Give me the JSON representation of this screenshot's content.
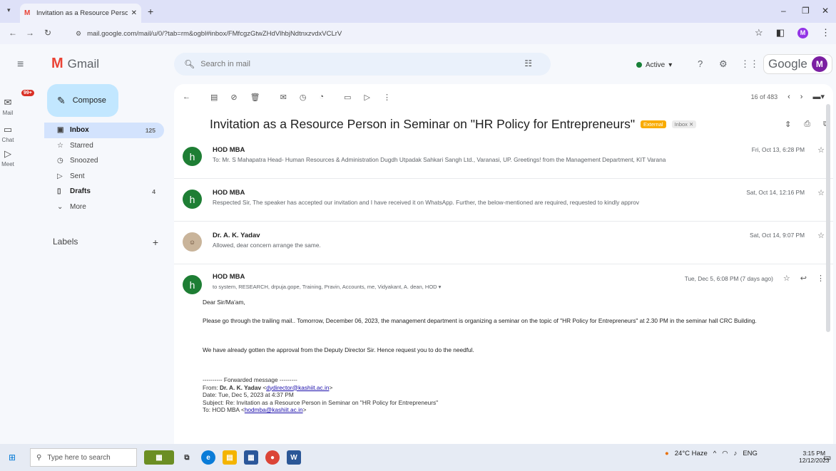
{
  "browser": {
    "tab_title": "Invitation as a Resource Perso",
    "url": "mail.google.com/mail/u/0/?tab=rm&ogbl#inbox/FMfcgzGtwZHdVlhbjNdtnxzvdxVCLrV"
  },
  "gmail": {
    "logo_text": "Gmail",
    "search_placeholder": "Search in mail",
    "status_label": "Active",
    "brand": "Google",
    "profile_initial": "M"
  },
  "rail": {
    "mail_label": "Mail",
    "mail_badge": "99+",
    "chat_label": "Chat",
    "meet_label": "Meet"
  },
  "nav": {
    "compose_label": "Compose",
    "items": [
      {
        "label": "Inbox",
        "count": "125"
      },
      {
        "label": "Starred",
        "count": ""
      },
      {
        "label": "Snoozed",
        "count": ""
      },
      {
        "label": "Sent",
        "count": ""
      },
      {
        "label": "Drafts",
        "count": "4"
      },
      {
        "label": "More",
        "count": ""
      }
    ],
    "labels_heading": "Labels"
  },
  "thread": {
    "pager": "16 of 483",
    "subject": "Invitation as a Resource Person in Seminar on \"HR Policy for Entrepreneurs\"",
    "badge_external": "External",
    "badge_inbox": "Inbox",
    "messages": [
      {
        "from": "HOD MBA",
        "snippet": "To: Mr. S Mahapatra Head- Human Resources & Administration Dugdh Utpadak Sahkari Sangh Ltd., Varanasi, UP. Greetings! from the Management Department, KIT Varana",
        "date": "Fri, Oct 13, 6:28 PM",
        "avatar": "h"
      },
      {
        "from": "HOD MBA",
        "snippet": "Respected Sir, The speaker has accepted our invitation and I have received it on WhatsApp. Further, the below-mentioned are required, requested to kindly approv",
        "date": "Sat, Oct 14, 12:16 PM",
        "avatar": "h"
      },
      {
        "from": "Dr. A. K. Yadav",
        "snippet": "Allowed, dear concern arrange the same.",
        "date": "Sat, Oct 14, 9:07 PM",
        "avatar": ""
      }
    ],
    "open_message": {
      "from": "HOD MBA",
      "avatar": "h",
      "to_line": "to system, RESEARCH, drpuja.gope, Training, Pravin, Accounts, me, Vidyakant, A. dean, HOD ▾",
      "date": "Tue, Dec 5, 6:08 PM (7 days ago)",
      "greeting": "Dear Sir/Ma'am,",
      "para1": "Please go through the trailing mail.. Tomorrow, December 06, 2023, the management department is organizing a seminar on the topic of \"HR Policy for Entrepreneurs\" at 2.30 PM in the seminar hall CRC Building.",
      "para2": "We have already gotten the approval from the Deputy Director Sir. Hence request you to do the needful.",
      "fwd_header": "---------- Forwarded message ---------",
      "fwd_from_label": "From: ",
      "fwd_from_name": "Dr. A. K. Yadav",
      "fwd_from_email": "dydirector@kashiit.ac.in",
      "fwd_date": "Date: Tue, Dec 5, 2023 at 4:37 PM",
      "fwd_subject": "Subject: Re: Invitation as a Resource Person in Seminar on \"HR Policy for Entrepreneurs\"",
      "fwd_to_label": "To: HOD MBA ",
      "fwd_to_email": "hodmba@kashiit.ac.in"
    }
  },
  "taskbar": {
    "search_placeholder": "Type here to search",
    "weather": "24°C Haze",
    "time": "3:15 PM",
    "date": "12/12/2023"
  }
}
